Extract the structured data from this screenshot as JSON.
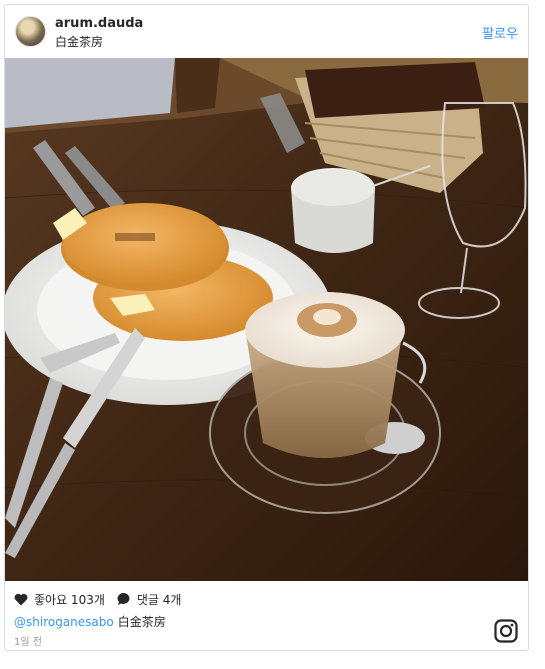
{
  "post": {
    "username": "arum.dauda",
    "location": "白金茶房",
    "follow_label": "팔로우",
    "likes_label": "좋아요 103개",
    "comments_label": "댓글 4개",
    "caption_handle": "@shiroganesabo",
    "caption_text": "白金茶房",
    "time_ago": "1일 전",
    "photo_icon": "pancakes-and-latte-photo",
    "like_icon": "heart-icon",
    "comment_icon": "speech-bubble-icon",
    "brand_icon": "instagram-icon"
  },
  "colors": {
    "link": "#3897f0",
    "text": "#262626",
    "muted": "#999999",
    "border": "#dbdbdb"
  }
}
